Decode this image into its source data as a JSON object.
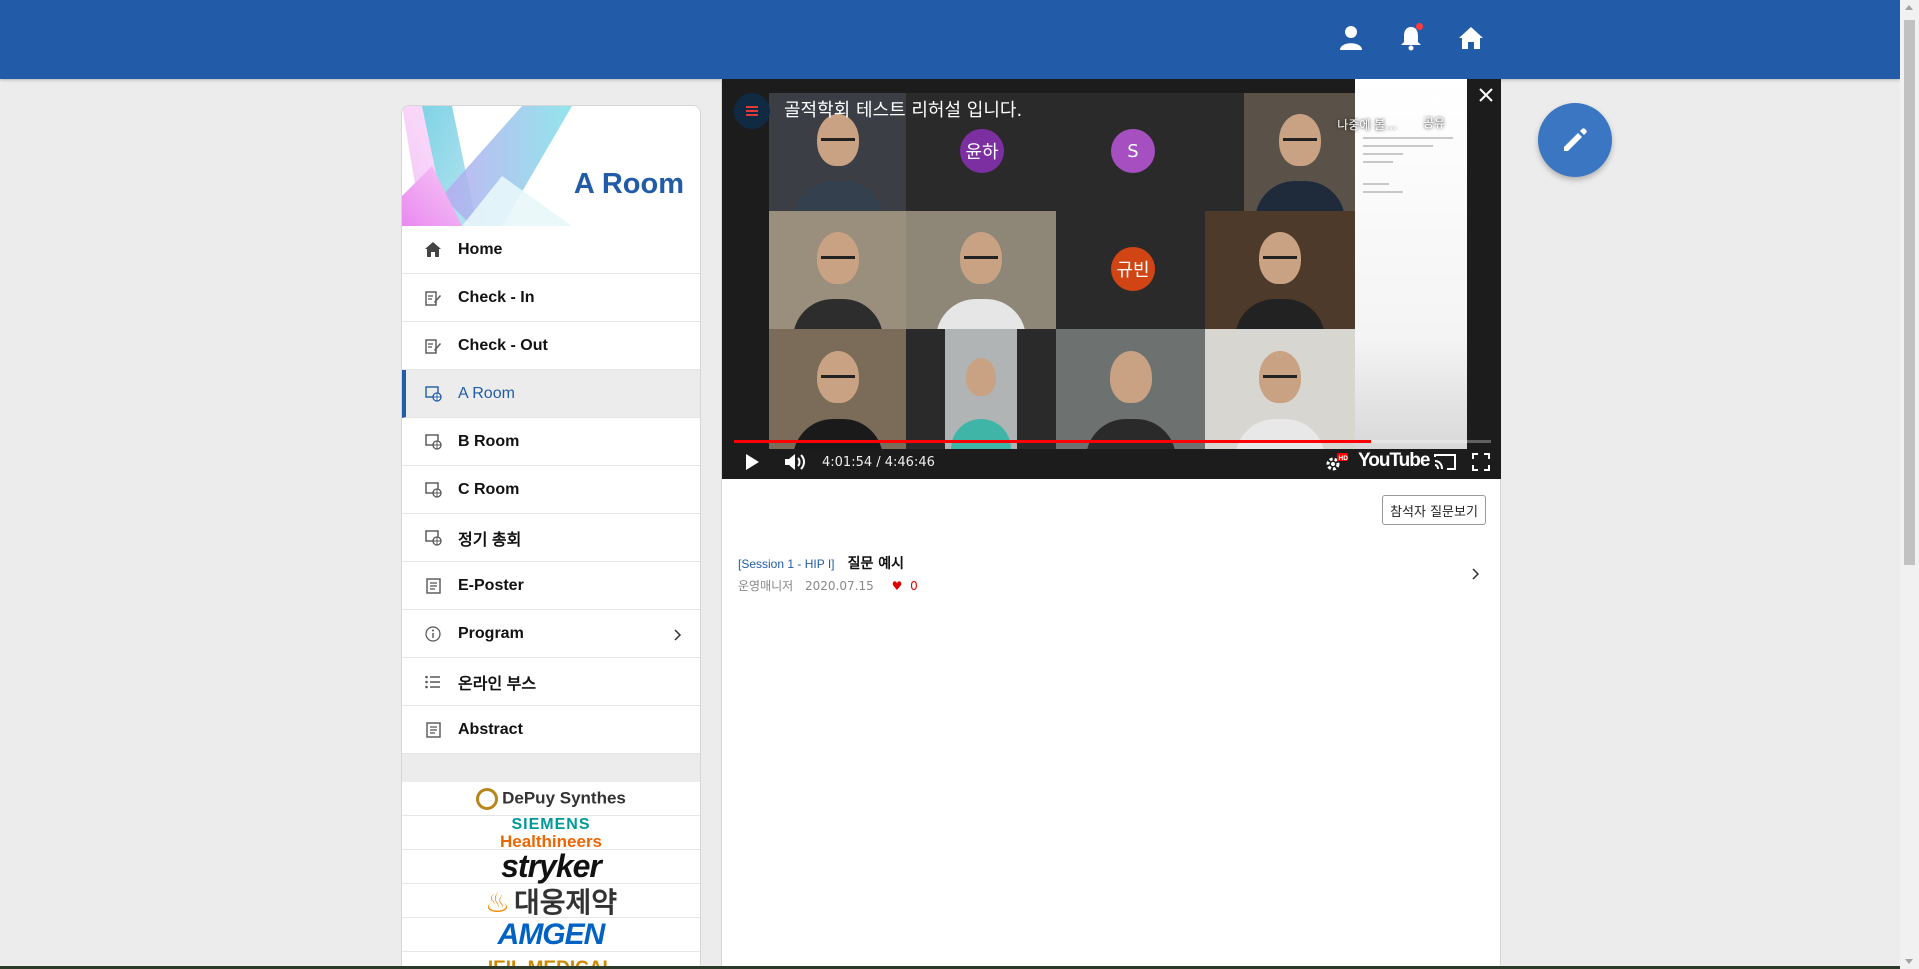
{
  "header": {
    "icons": [
      "user-icon",
      "bell-icon",
      "home-icon"
    ],
    "bell_has_notification": true,
    "color": "#225ca8"
  },
  "sidebar": {
    "title": "A Room",
    "items": [
      {
        "label": "Home",
        "icon": "home-icon",
        "active": false
      },
      {
        "label": "Check - In",
        "icon": "edit-note-icon",
        "active": false
      },
      {
        "label": "Check - Out",
        "icon": "edit-note-icon",
        "active": false
      },
      {
        "label": "A Room",
        "icon": "screen-globe-icon",
        "active": true
      },
      {
        "label": "B Room",
        "icon": "screen-globe-icon",
        "active": false
      },
      {
        "label": "C Room",
        "icon": "screen-globe-icon",
        "active": false
      },
      {
        "label": "정기 총회",
        "icon": "screen-globe-icon",
        "active": false
      },
      {
        "label": "E-Poster",
        "icon": "document-icon",
        "active": false
      },
      {
        "label": "Program",
        "icon": "info-icon",
        "active": false,
        "has_submenu": true
      },
      {
        "label": "온라인 부스",
        "icon": "list-icon",
        "active": false
      },
      {
        "label": "Abstract",
        "icon": "document-icon",
        "active": false
      }
    ],
    "sponsors": {
      "depuy": "DePuy Synthes",
      "siemens_top": "SIEMENS",
      "siemens_bottom": "Healthineers",
      "stryker": "stryker",
      "daewoong": "대웅제약",
      "amgen": "AMGEN",
      "ieil": "IEIL MEDICAL"
    }
  },
  "video": {
    "title": "골적학회 테스트 리허설 입니다.",
    "participants": [
      "윤하",
      "S",
      "규빈"
    ],
    "watch_later_label": "나중에 볼...",
    "share_label": "공유",
    "current_time": "4:01:54",
    "duration": "4:46:46",
    "time_display": "4:01:54 / 4:46:46",
    "progress_fraction": 0.842,
    "brand": "YouTube",
    "hd_badge": "HD"
  },
  "questions": {
    "view_button_label": "참석자 질문보기",
    "items": [
      {
        "session": "[Session 1 - HIP I]",
        "title": "질문 예시",
        "author": "운영매니저",
        "date": "2020.07.15",
        "likes": "0"
      }
    ]
  }
}
